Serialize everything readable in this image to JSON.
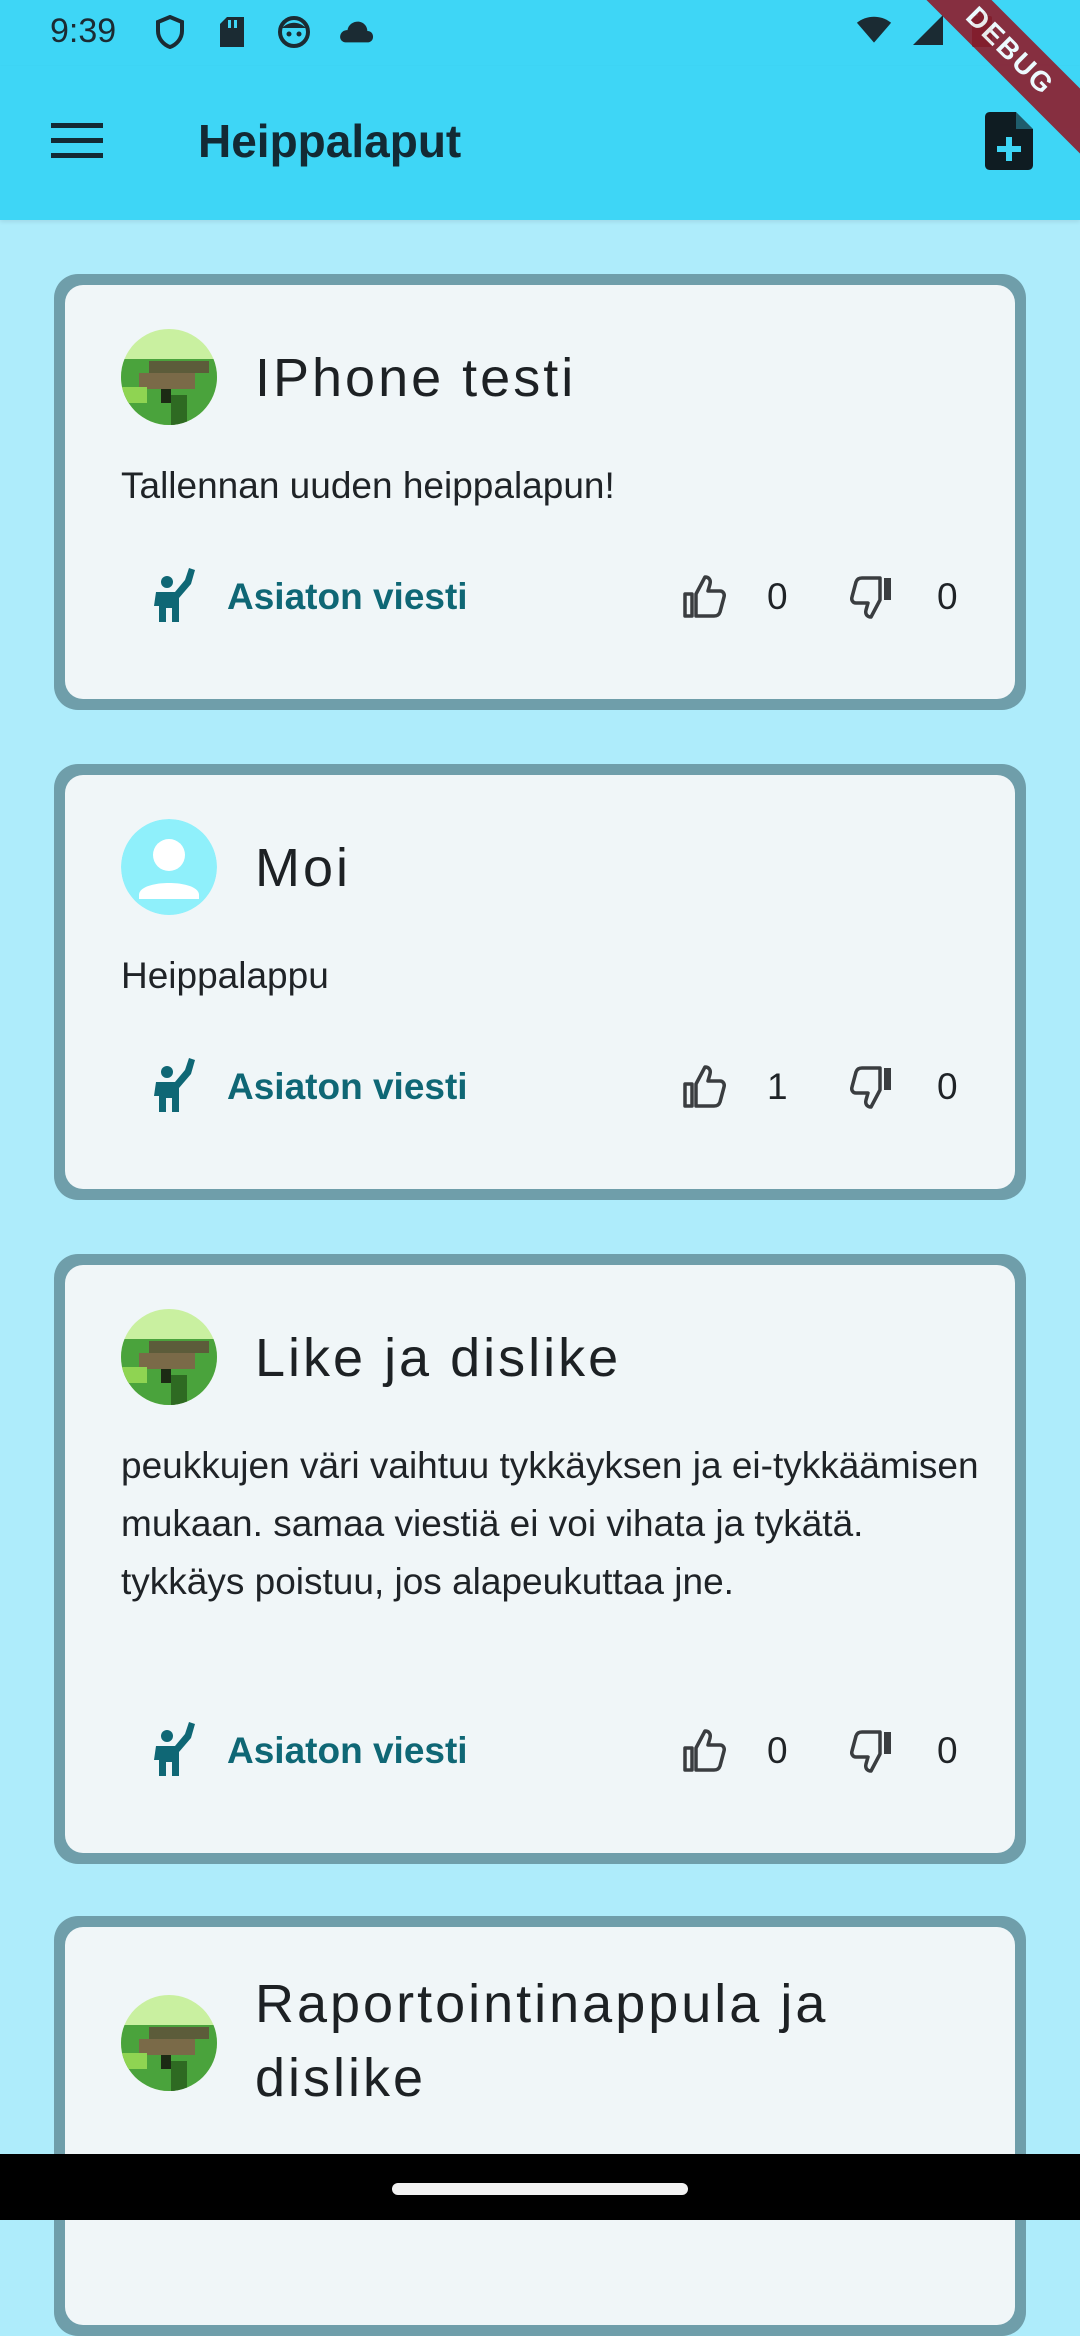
{
  "status_bar": {
    "time": "9:39",
    "left_icons": [
      "shield-icon",
      "sd-card-icon",
      "face-icon",
      "cloud-icon"
    ],
    "right_icons": [
      "wifi-icon",
      "signal-icon",
      "battery-icon"
    ]
  },
  "app_bar": {
    "title": "Heippalaput",
    "menu_icon": "hamburger-menu-icon",
    "action_icon": "note-add-icon"
  },
  "debug_banner": "DEBUG",
  "colors": {
    "app_bar": "#3ed6f6",
    "background": "#aeecfb",
    "card_border": "#6f9eaa",
    "card_surface": "#f0f6f8",
    "accent": "#0f6775"
  },
  "posts": [
    {
      "title": "IPhone testi",
      "body": "Tallennan uuden heippalapun!",
      "avatar": "pixel-avatar-icon",
      "report_label": "Asiaton viesti",
      "likes": "0",
      "dislikes": "0"
    },
    {
      "title": "Moi",
      "body": "Heippalappu",
      "avatar": "default-person-avatar-icon",
      "report_label": "Asiaton viesti",
      "likes": "1",
      "dislikes": "0"
    },
    {
      "title": "Like ja dislike",
      "body": "peukkujen väri vaihtuu tykkäyksen ja ei-tykkäämisen mukaan. samaa viestiä ei voi vihata ja tykätä. tykkäys poistuu, jos alapeukuttaa jne.",
      "avatar": "pixel-avatar-icon",
      "report_label": "Asiaton viesti",
      "likes": "0",
      "dislikes": "0"
    },
    {
      "title": "Raportointinappula ja dislike",
      "avatar": "pixel-avatar-icon"
    }
  ]
}
